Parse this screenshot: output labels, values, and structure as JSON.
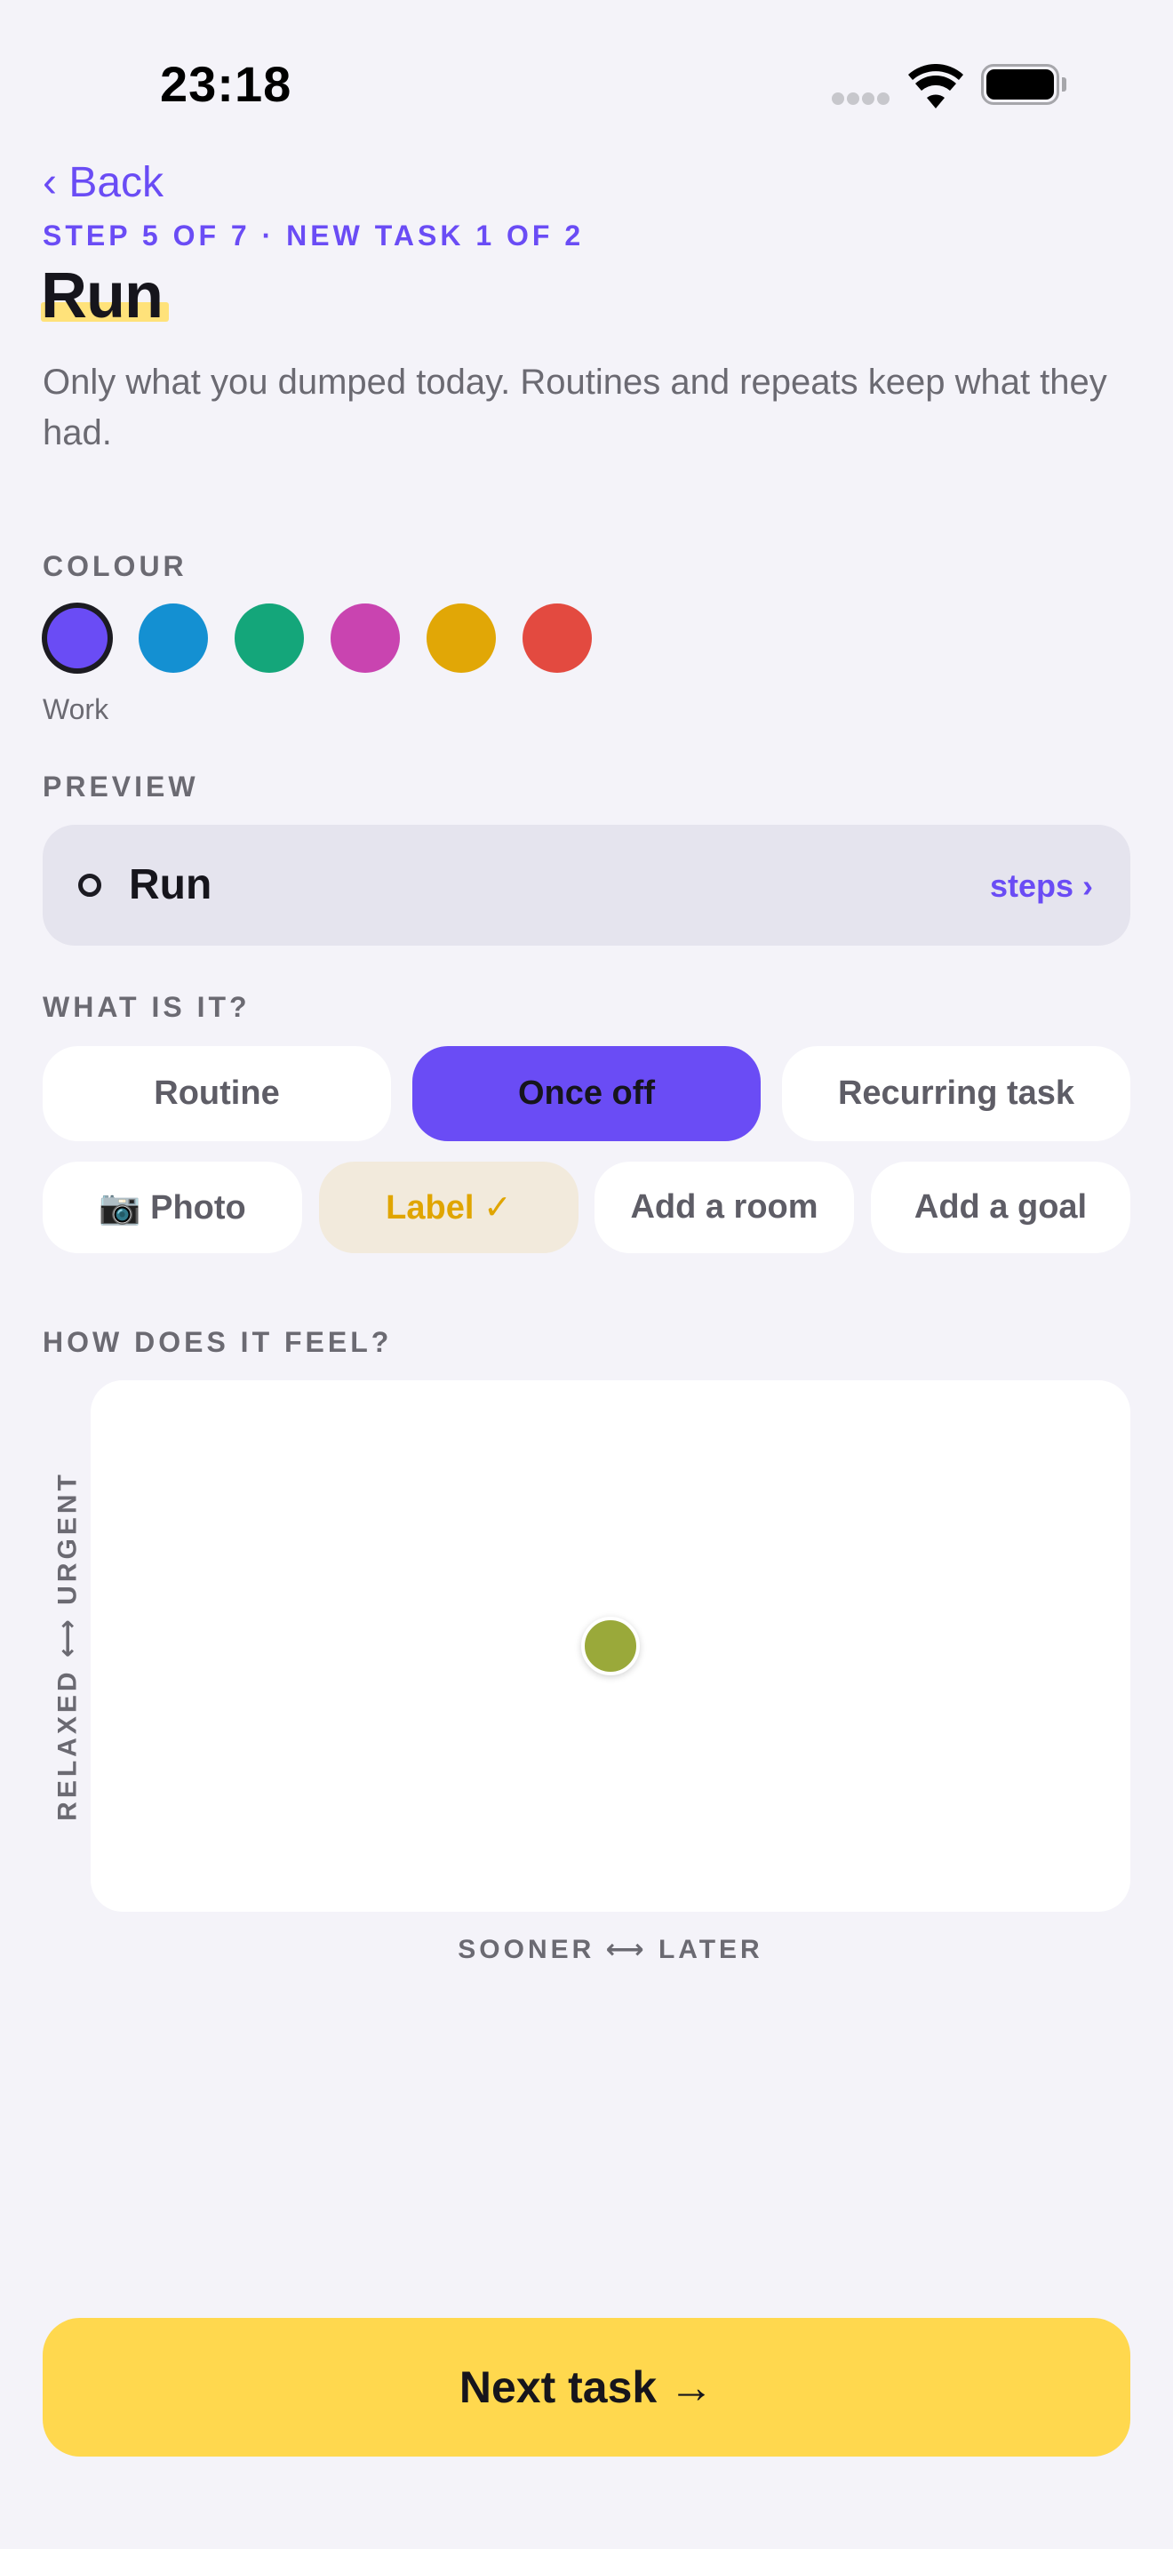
{
  "status_bar": {
    "time": "23:18",
    "signal_icon": "cellular-signal-icon",
    "wifi_icon": "wifi-icon",
    "battery_icon": "battery-full-icon"
  },
  "nav": {
    "back_label": "‹ Back"
  },
  "header": {
    "step": "STEP 5 OF 7 · NEW TASK 1 OF 2",
    "title": "Run",
    "subtitle": "Only what you dumped today. Routines and repeats keep what they had."
  },
  "colour": {
    "section_label": "COLOUR",
    "selected_name": "Work",
    "swatches": [
      {
        "hex": "#6A4CF5",
        "selected": true
      },
      {
        "hex": "#1490D2",
        "selected": false
      },
      {
        "hex": "#14A67A",
        "selected": false
      },
      {
        "hex": "#C944B0",
        "selected": false
      },
      {
        "hex": "#E1A706",
        "selected": false
      },
      {
        "hex": "#E34A40",
        "selected": false
      }
    ]
  },
  "preview": {
    "section_label": "PREVIEW",
    "task_title": "Run",
    "steps_label": "steps ›"
  },
  "what_is_it": {
    "section_label": "WHAT IS IT?",
    "types": [
      {
        "label": "Routine",
        "selected": false
      },
      {
        "label": "Once off",
        "selected": true
      },
      {
        "label": "Recurring task",
        "selected": false
      }
    ],
    "extras": [
      {
        "label": "📷 Photo",
        "icon": "camera-icon"
      },
      {
        "label": "Label ✓",
        "icon": "checkmark-icon"
      },
      {
        "label": "Add a room"
      },
      {
        "label": "Add a goal"
      }
    ]
  },
  "feel": {
    "section_label": "HOW DOES IT FEEL?",
    "y_axis_label": "RELAXED ⟷ URGENT",
    "x_axis_label": "SOONER ⟷ LATER",
    "handle_color": "#9AA93A",
    "handle_x_fraction": 0.5,
    "handle_y_fraction": 0.5
  },
  "footer": {
    "next_label": "Next task →"
  },
  "colors": {
    "accent": "#6A4CF5",
    "primary_button": "#FFD84E",
    "background": "#F4F3F9"
  }
}
